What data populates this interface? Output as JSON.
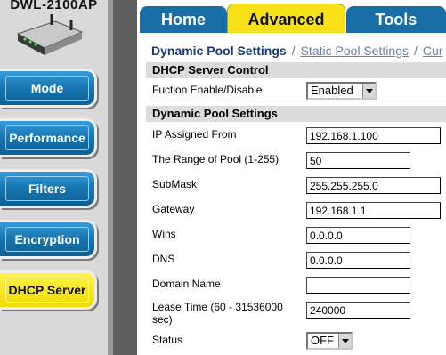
{
  "sidebar": {
    "model": "DWL-2100AP",
    "items": [
      {
        "label": "Mode"
      },
      {
        "label": "Performance"
      },
      {
        "label": "Filters"
      },
      {
        "label": "Encryption"
      },
      {
        "label": "DHCP Server",
        "active": true
      }
    ]
  },
  "tabs": [
    {
      "label": "Home"
    },
    {
      "label": "Advanced",
      "active": true
    },
    {
      "label": "Tools"
    }
  ],
  "subnav": {
    "current": "Dynamic Pool Settings",
    "separator": "/",
    "static": "Static Pool Settings",
    "next": "Cur"
  },
  "dhcp_control": {
    "title": "DHCP Server Control",
    "function_label": "Fuction Enable/Disable",
    "function_value": "Enabled"
  },
  "dynamic_pool": {
    "title": "Dynamic Pool Settings",
    "ip_from_label": "IP Assigned From",
    "ip_from_value": "192.168.1.100",
    "range_label": "The Range of Pool (1-255)",
    "range_value": "50",
    "submask_label": "SubMask",
    "submask_value": "255.255.255.0",
    "gateway_label": "Gateway",
    "gateway_value": "192.168.1.1",
    "wins_label": "Wins",
    "wins_value": "0.0.0.0",
    "dns_label": "DNS",
    "dns_value": "0.0.0.0",
    "domain_label": "Domain Name",
    "domain_value": "",
    "lease_label": "Lease Time (60 - 31536000 sec)",
    "lease_value": "240000",
    "status_label": "Status",
    "status_value": "OFF"
  },
  "colors": {
    "nav_blue": "#1877b3",
    "nav_active_yellow": "#f1db00",
    "tab_blue": "#1a6ea8",
    "tab_active_yellow": "#f7e21a",
    "section_gray": "#dcdcdc",
    "heading_navy": "#163b7a"
  }
}
